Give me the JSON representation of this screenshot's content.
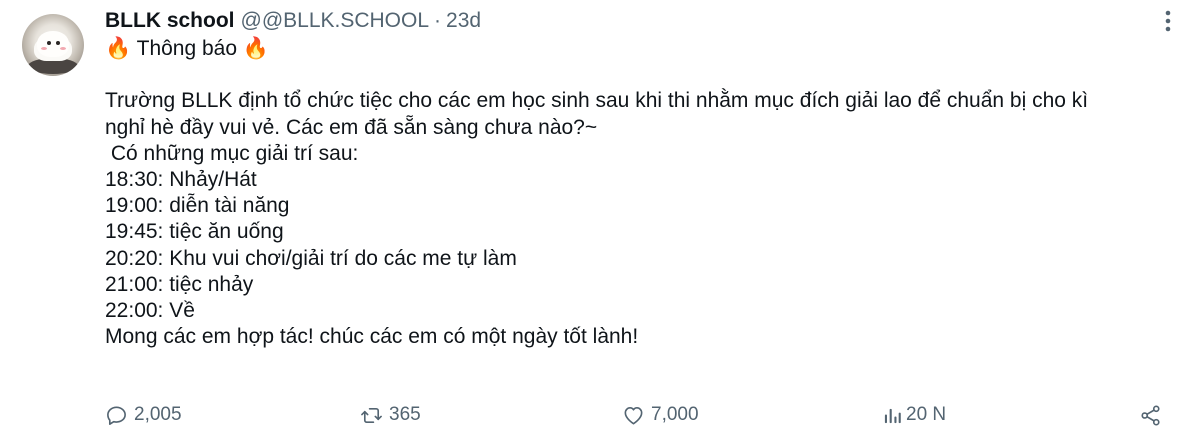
{
  "colors": {
    "text": "#0f1419",
    "secondary": "#536471",
    "background": "#ffffff"
  },
  "header": {
    "display_name": "BLLK school",
    "handle": "@@BLLK.SCHOOL",
    "separator": "·",
    "time": "23d"
  },
  "body": {
    "title_prefix_icon": "🔥",
    "title": "Thông báo",
    "title_suffix_icon": "🔥",
    "paragraph_line1": "Trường BLLK định tổ chức tiệc cho các em học sinh sau khi thi nhằm mục đích giải lao để chuẩn bị cho kì",
    "paragraph_line2": "nghỉ hè đầy vui vẻ. Các em đã sẵn sàng chưa nào?~",
    "list_intro": " Có những mục giải trí sau:",
    "schedule": [
      "18:30: Nhảy/Hát",
      "19:00: diễn tài năng",
      "19:45: tiệc ăn uống",
      "20:20: Khu vui chơi/giải trí do các me tự làm",
      "21:00: tiệc nhảy",
      "22:00: Về"
    ],
    "closing": "Mong các em hợp tác! chúc các em có một ngày tốt lành!"
  },
  "actions": {
    "reply": {
      "icon": "reply-icon",
      "count": "2,005"
    },
    "retweet": {
      "icon": "retweet-icon",
      "count": "365"
    },
    "like": {
      "icon": "heart-icon",
      "count": "7,000"
    },
    "views": {
      "icon": "views-icon",
      "count": "20 N"
    },
    "share": {
      "icon": "share-icon"
    }
  },
  "more": {
    "icon": "more-vertical-icon"
  }
}
